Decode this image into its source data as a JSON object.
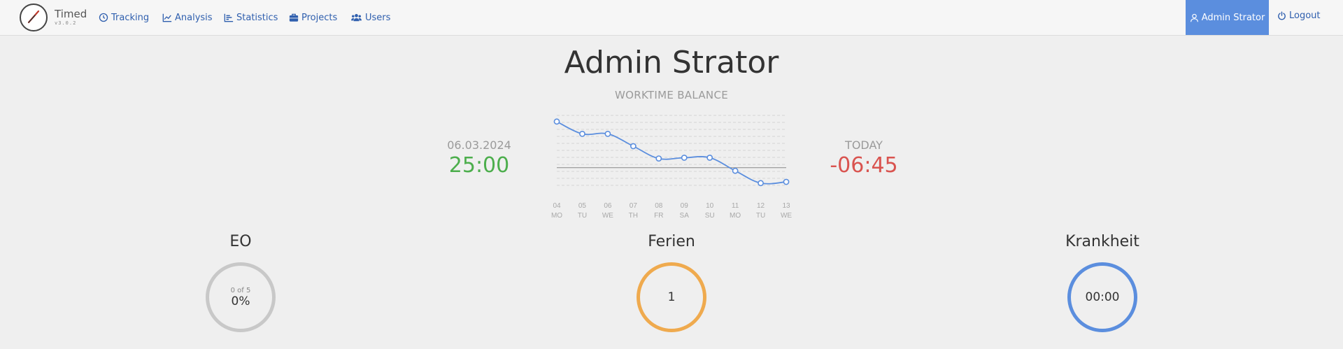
{
  "nav": {
    "brand": "Timed",
    "version": "v3.0.2",
    "links": [
      {
        "label": "Tracking",
        "icon": "clock-icon"
      },
      {
        "label": "Analysis",
        "icon": "line-chart-icon"
      },
      {
        "label": "Statistics",
        "icon": "bar-chart-icon"
      },
      {
        "label": "Projects",
        "icon": "briefcase-icon"
      },
      {
        "label": "Users",
        "icon": "users-icon"
      }
    ],
    "user": "Admin Strator",
    "logout": "Logout"
  },
  "main": {
    "name": "Admin Strator",
    "section": "WORKTIME BALANCE",
    "left": {
      "date": "06.03.2024",
      "value": "25:00"
    },
    "right": {
      "label": "TODAY",
      "value": "-06:45"
    }
  },
  "chart_data": {
    "type": "line",
    "x": [
      "04",
      "05",
      "06",
      "07",
      "08",
      "09",
      "10",
      "11",
      "12",
      "13"
    ],
    "weekdays": [
      "MO",
      "TU",
      "WE",
      "TH",
      "FR",
      "SA",
      "SU",
      "MO",
      "TU",
      "WE"
    ],
    "values": [
      38,
      34,
      34,
      30,
      26,
      26.25,
      26.25,
      22,
      18,
      18.4
    ],
    "ylim": [
      15,
      40
    ],
    "baseline": 23,
    "color": "#5b8ede",
    "grid": true
  },
  "stats": [
    {
      "title": "EO",
      "small": "0 of 5",
      "big": "0%",
      "color": "#c8c8c8"
    },
    {
      "title": "Ferien",
      "small": "",
      "big": "1",
      "color": "#efaa4e"
    },
    {
      "title": "Krankheit",
      "small": "",
      "big": "00:00",
      "color": "#5b8ede"
    }
  ]
}
